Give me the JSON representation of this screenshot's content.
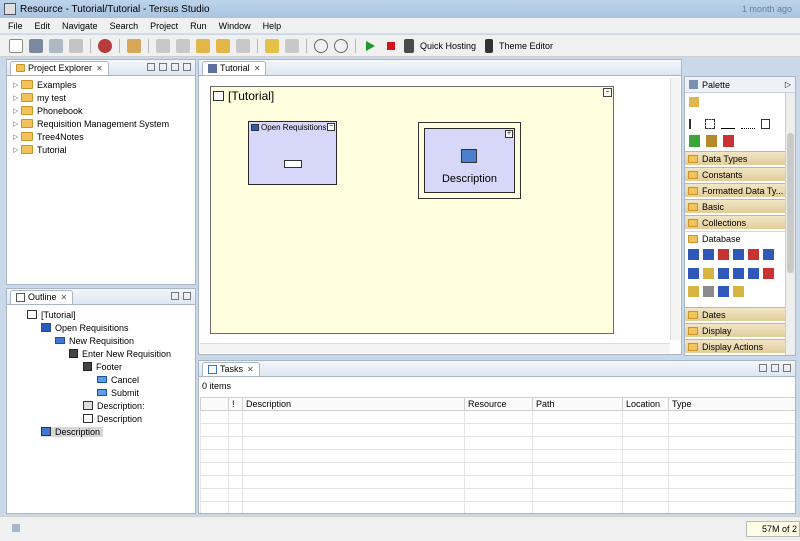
{
  "window": {
    "title": "Resource - Tutorial/Tutorial - Tersus Studio",
    "clock": "1 month ago"
  },
  "menu": [
    "File",
    "Edit",
    "Navigate",
    "Search",
    "Project",
    "Run",
    "Window",
    "Help"
  ],
  "toolbar": {
    "quick_hosting": "Quick Hosting",
    "theme_editor": "Theme Editor"
  },
  "project_explorer": {
    "tab": "Project Explorer",
    "items": [
      "Examples",
      "my test",
      "Phonebook",
      "Requisition Management System",
      "Tree4Notes",
      "Tutorial"
    ]
  },
  "outline": {
    "tab": "Outline",
    "items": [
      {
        "label": "[Tutorial]",
        "icon": "tutorial-icon"
      },
      {
        "label": "Open Requisitions",
        "icon": "open-requisitions-icon"
      },
      {
        "label": "New Requisition",
        "icon": "new-requisition-icon"
      },
      {
        "label": "Enter New Requisition",
        "icon": "enter-requisition-icon"
      },
      {
        "label": "Footer",
        "icon": "footer-icon"
      },
      {
        "label": "Cancel",
        "icon": "cancel-icon"
      },
      {
        "label": "Submit",
        "icon": "submit-icon"
      },
      {
        "label": "Description:",
        "icon": "description-label-icon"
      },
      {
        "label": "Description",
        "icon": "description-field-icon"
      },
      {
        "label": "Description",
        "icon": "description-icon"
      }
    ]
  },
  "editor": {
    "tab": "Tutorial",
    "canvas_title": "[Tutorial]",
    "box_open_requisitions": "Open Requisitions",
    "box_description": "Description"
  },
  "palette": {
    "title": "Palette",
    "categories": [
      "Data Types",
      "Constants",
      "Formatted Data Ty...",
      "Basic",
      "Collections",
      "Database",
      "Dates",
      "Display",
      "Display Actions"
    ]
  },
  "tasks": {
    "tab": "Tasks",
    "count": "0 items",
    "columns": [
      "!",
      "Description",
      "Resource",
      "Path",
      "Location",
      "Type"
    ]
  },
  "status": {
    "memory": "57M of 2"
  }
}
